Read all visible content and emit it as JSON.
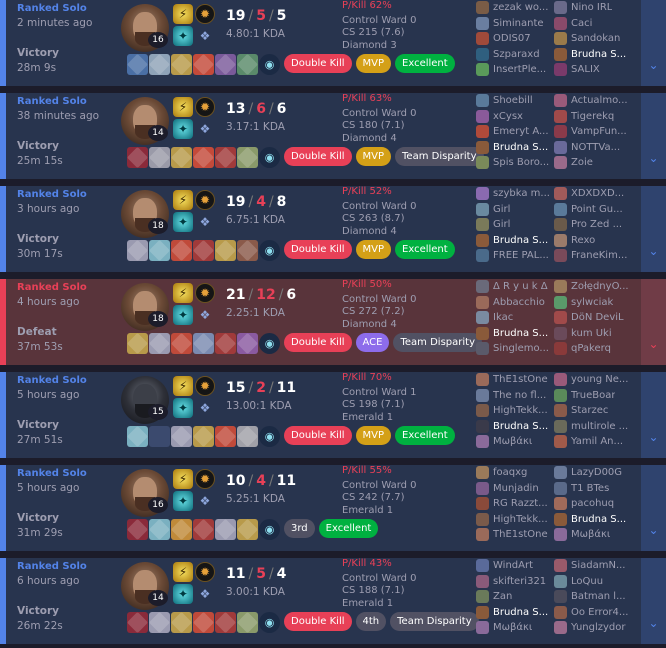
{
  "matches": [
    {
      "result_class": "win",
      "queue": "Ranked Solo",
      "ago": "2 minutes ago",
      "result": "Victory",
      "duration": "28m 9s",
      "champ_level": "16",
      "champ_style": "normal",
      "kills": "19",
      "deaths": "5",
      "assists": "5",
      "kda_ratio": "4.80:1 KDA",
      "pkill": "P/Kill 62%",
      "control_ward": "Control Ward 0",
      "cs": "CS 215 (7.6)",
      "rank": "Diamond 3",
      "badges": [
        {
          "label": "Double Kill",
          "color": "red"
        },
        {
          "label": "MVP",
          "color": "gold"
        },
        {
          "label": "Excellent",
          "color": "green"
        }
      ],
      "items": [
        "#4a6fa5",
        "#8fa3b8",
        "#b89a4a",
        "#c44a3a",
        "#7a5a9a",
        "#5a8a6a",
        "#b0b0b8"
      ],
      "team1": [
        {
          "name": "zezak wo...",
          "color": "#7a5c46"
        },
        {
          "name": "Siminante",
          "color": "#6a7ea0"
        },
        {
          "name": "ODIS07",
          "color": "#a04a3a"
        },
        {
          "name": "Szparaxd",
          "color": "#2f5f7f"
        },
        {
          "name": "InsertPle...",
          "color": "#5a9a5a"
        }
      ],
      "team2": [
        {
          "name": "Nino IRL",
          "color": "#6a6a8a"
        },
        {
          "name": "Caci",
          "color": "#8a4a6a"
        },
        {
          "name": "Sandokan",
          "color": "#9a7a4a"
        },
        {
          "name": "Brudna S...",
          "color": "#8a5a3a",
          "me": true
        },
        {
          "name": "SALIX",
          "color": "#7a3a6a"
        }
      ]
    },
    {
      "result_class": "win",
      "queue": "Ranked Solo",
      "ago": "38 minutes ago",
      "result": "Victory",
      "duration": "25m 15s",
      "champ_level": "14",
      "champ_style": "normal",
      "kills": "13",
      "deaths": "6",
      "assists": "6",
      "kda_ratio": "3.17:1 KDA",
      "pkill": "P/Kill 63%",
      "control_ward": "Control Ward 0",
      "cs": "CS 180 (7.1)",
      "rank": "Diamond 4",
      "badges": [
        {
          "label": "Double Kill",
          "color": "red"
        },
        {
          "label": "MVP",
          "color": "gold"
        },
        {
          "label": "Team Disparity",
          "color": "team"
        }
      ],
      "items": [
        "#8a2a3a",
        "#9a9aa8",
        "#b89a4a",
        "#c44a3a",
        "#a03a3a",
        "#8a9a6a",
        "#b0b0b8"
      ],
      "team1": [
        {
          "name": "Shoebill",
          "color": "#5a7a9a"
        },
        {
          "name": "xCysx",
          "color": "#8a5a9a"
        },
        {
          "name": "Emeryt A...",
          "color": "#b04a3a"
        },
        {
          "name": "Brudna S...",
          "color": "#8a5a3a",
          "me": true
        },
        {
          "name": "Spis Boro...",
          "color": "#7a8a5a"
        }
      ],
      "team2": [
        {
          "name": "Actualmo...",
          "color": "#9a5a7a"
        },
        {
          "name": "Tigerekq",
          "color": "#a04a4a"
        },
        {
          "name": "VampFun...",
          "color": "#8a3a4a"
        },
        {
          "name": "NOTTVa...",
          "color": "#6a6a9a"
        },
        {
          "name": "Zoie",
          "color": "#9a6a8a"
        }
      ]
    },
    {
      "result_class": "win",
      "queue": "Ranked Solo",
      "ago": "3 hours ago",
      "result": "Victory",
      "duration": "30m 17s",
      "champ_level": "18",
      "champ_style": "normal",
      "kills": "19",
      "deaths": "4",
      "assists": "8",
      "kda_ratio": "6.75:1 KDA",
      "pkill": "P/Kill 52%",
      "control_ward": "Control Ward 0",
      "cs": "CS 263 (8.7)",
      "rank": "Diamond 4",
      "badges": [
        {
          "label": "Double Kill",
          "color": "red"
        },
        {
          "label": "MVP",
          "color": "gold"
        },
        {
          "label": "Excellent",
          "color": "green"
        }
      ],
      "items": [
        "#9a9ab0",
        "#7ab0c0",
        "#c04a3a",
        "#a03a3a",
        "#b89a4a",
        "#8a5a4a",
        "#b0b0b8"
      ],
      "team1": [
        {
          "name": "szybka m...",
          "color": "#8a6ab0"
        },
        {
          "name": "Girl",
          "color": "#6a8aa0"
        },
        {
          "name": "Girl",
          "color": "#7a7a5a"
        },
        {
          "name": "Brudna S...",
          "color": "#8a5a3a",
          "me": true
        },
        {
          "name": "FREE PAL...",
          "color": "#4a6a8a"
        }
      ],
      "team2": [
        {
          "name": "XDXDXD...",
          "color": "#a05a5a"
        },
        {
          "name": "Point Gu...",
          "color": "#5a7a9a"
        },
        {
          "name": "Pro Zed ...",
          "color": "#6a5a4a"
        },
        {
          "name": "Rexo",
          "color": "#9a7a6a"
        },
        {
          "name": "FraneKim...",
          "color": "#7a4a5a"
        }
      ]
    },
    {
      "result_class": "loss",
      "queue": "Ranked Solo",
      "ago": "4 hours ago",
      "result": "Defeat",
      "duration": "37m 53s",
      "champ_level": "18",
      "champ_style": "normal",
      "kills": "21",
      "deaths": "12",
      "assists": "6",
      "kda_ratio": "2.25:1 KDA",
      "pkill": "P/Kill 50%",
      "control_ward": "Control Ward 0",
      "cs": "CS 272 (7.2)",
      "rank": "Diamond 4",
      "badges": [
        {
          "label": "Double Kill",
          "color": "red"
        },
        {
          "label": "ACE",
          "color": "purple"
        },
        {
          "label": "Team Disparity",
          "color": "team"
        }
      ],
      "items": [
        "#b89a4a",
        "#9a9ab0",
        "#c04a3a",
        "#7a8ab0",
        "#a03a3a",
        "#8a5aa0",
        "#b0b0b8"
      ],
      "team1": [
        {
          "name": "Δ R y u k Δ",
          "color": "#6a6a7a"
        },
        {
          "name": "Abbacchio",
          "color": "#9a6a5a"
        },
        {
          "name": "Ikac",
          "color": "#7a8aa0"
        },
        {
          "name": "Brudna S...",
          "color": "#8a5a3a",
          "me": true
        },
        {
          "name": "Singlemo...",
          "color": "#5a5a6a"
        }
      ],
      "team2": [
        {
          "name": "ŻołędnyO...",
          "color": "#9a7a5a"
        },
        {
          "name": "sylwciak",
          "color": "#5a9a6a"
        },
        {
          "name": "DöN DeviL",
          "color": "#a04a4a"
        },
        {
          "name": "kum Uki",
          "color": "#6a4a5a"
        },
        {
          "name": "qPakerq",
          "color": "#8a3a3a"
        }
      ]
    },
    {
      "result_class": "win",
      "queue": "Ranked Solo",
      "ago": "5 hours ago",
      "result": "Victory",
      "duration": "27m 51s",
      "champ_level": "15",
      "champ_style": "dark",
      "kills": "15",
      "deaths": "2",
      "assists": "11",
      "kda_ratio": "13.00:1 KDA",
      "pkill": "P/Kill 70%",
      "control_ward": "Control Ward 1",
      "cs": "CS 198 (7.1)",
      "rank": "Emerald 1",
      "badges": [
        {
          "label": "Double Kill",
          "color": "red"
        },
        {
          "label": "MVP",
          "color": "gold"
        },
        {
          "label": "Excellent",
          "color": "green"
        }
      ],
      "items": [
        "#7ab0c0",
        "empty",
        "#9a9ab0",
        "#b89a4a",
        "#c04a3a",
        "#a0a0a8",
        "#b0b0b8"
      ],
      "team1": [
        {
          "name": "ThE1stOne",
          "color": "#9a6a5a"
        },
        {
          "name": "The no fl...",
          "color": "#6a7a9a"
        },
        {
          "name": "HighTekk...",
          "color": "#7a5a4a"
        },
        {
          "name": "Brudna S...",
          "color": "#3a3a4a",
          "me": true
        },
        {
          "name": "Μωβάκι",
          "color": "#8a6a9a"
        }
      ],
      "team2": [
        {
          "name": "young Ne...",
          "color": "#9a5a7a"
        },
        {
          "name": "TrueBoar",
          "color": "#5a8a5a"
        },
        {
          "name": "Starzec",
          "color": "#8a5a4a"
        },
        {
          "name": "multirole ...",
          "color": "#6a6a5a"
        },
        {
          "name": "Yamil An...",
          "color": "#a05a4a"
        }
      ]
    },
    {
      "result_class": "win",
      "queue": "Ranked Solo",
      "ago": "5 hours ago",
      "result": "Victory",
      "duration": "31m 29s",
      "champ_level": "16",
      "champ_style": "normal",
      "kills": "10",
      "deaths": "4",
      "assists": "11",
      "kda_ratio": "5.25:1 KDA",
      "pkill": "P/Kill 55%",
      "control_ward": "Control Ward 0",
      "cs": "CS 242 (7.7)",
      "rank": "Emerald 1",
      "badges": [
        {
          "label": "3rd",
          "color": "grey"
        },
        {
          "label": "Excellent",
          "color": "green"
        }
      ],
      "items": [
        "#8a2a3a",
        "#7ab0c0",
        "#c08a3a",
        "#a03a3a",
        "#9a9ab0",
        "#b89a4a",
        "#b0b0b8"
      ],
      "team1": [
        {
          "name": "foaqxg",
          "color": "#9a7a5a"
        },
        {
          "name": "Munjadin",
          "color": "#7a5a8a"
        },
        {
          "name": "RG Razzt...",
          "color": "#8a4a3a"
        },
        {
          "name": "HighTekk...",
          "color": "#7a5a4a"
        },
        {
          "name": "ThE1stOne",
          "color": "#9a6a5a"
        }
      ],
      "team2": [
        {
          "name": "LazyD00G",
          "color": "#6a7a9a"
        },
        {
          "name": "T1 BTes",
          "color": "#5a6a8a"
        },
        {
          "name": "pacohuq",
          "color": "#a06a5a"
        },
        {
          "name": "Brudna S...",
          "color": "#8a5a3a",
          "me": true
        },
        {
          "name": "Μωβάκι",
          "color": "#8a6a9a"
        }
      ]
    },
    {
      "result_class": "win",
      "queue": "Ranked Solo",
      "ago": "6 hours ago",
      "result": "Victory",
      "duration": "26m 22s",
      "champ_level": "14",
      "champ_style": "normal",
      "kills": "11",
      "deaths": "5",
      "assists": "4",
      "kda_ratio": "3.00:1 KDA",
      "pkill": "P/Kill 43%",
      "control_ward": "Control Ward 0",
      "cs": "CS 188 (7.1)",
      "rank": "Emerald 1",
      "badges": [
        {
          "label": "Double Kill",
          "color": "red"
        },
        {
          "label": "4th",
          "color": "grey"
        },
        {
          "label": "Team Disparity",
          "color": "team"
        }
      ],
      "items": [
        "#8a2a3a",
        "#9a9ab0",
        "#b89a4a",
        "#c04a3a",
        "#a03a3a",
        "#8a9a6a",
        "#b0b0b8"
      ],
      "team1": [
        {
          "name": "WindArt",
          "color": "#5a6a9a"
        },
        {
          "name": "skifteri321",
          "color": "#8a5a7a"
        },
        {
          "name": "Zan",
          "color": "#6a7a5a"
        },
        {
          "name": "Brudna S...",
          "color": "#8a5a3a",
          "me": true
        },
        {
          "name": "Μωβάκι",
          "color": "#8a6a9a"
        }
      ],
      "team2": [
        {
          "name": "SiadamN...",
          "color": "#9a5a6a"
        },
        {
          "name": "LoQuu",
          "color": "#6a8a9a"
        },
        {
          "name": "Batman l...",
          "color": "#4a4a5a"
        },
        {
          "name": "Oo Error4...",
          "color": "#8a5a4a"
        },
        {
          "name": "Yunglzydor",
          "color": "#9a6a8a"
        }
      ]
    }
  ],
  "colors": {
    "win_accent": "#5383e8",
    "loss_accent": "#e84057",
    "win_bg": "#28344e",
    "loss_bg": "#59343b"
  },
  "icons": {
    "spell1": "flash-icon",
    "spell2": "ignite-icon",
    "rune_main": "keystone-rune-icon",
    "rune_sub": "secondary-rune-icon",
    "ward": "trinket-ward-icon",
    "expand": "chevron-down-icon"
  }
}
